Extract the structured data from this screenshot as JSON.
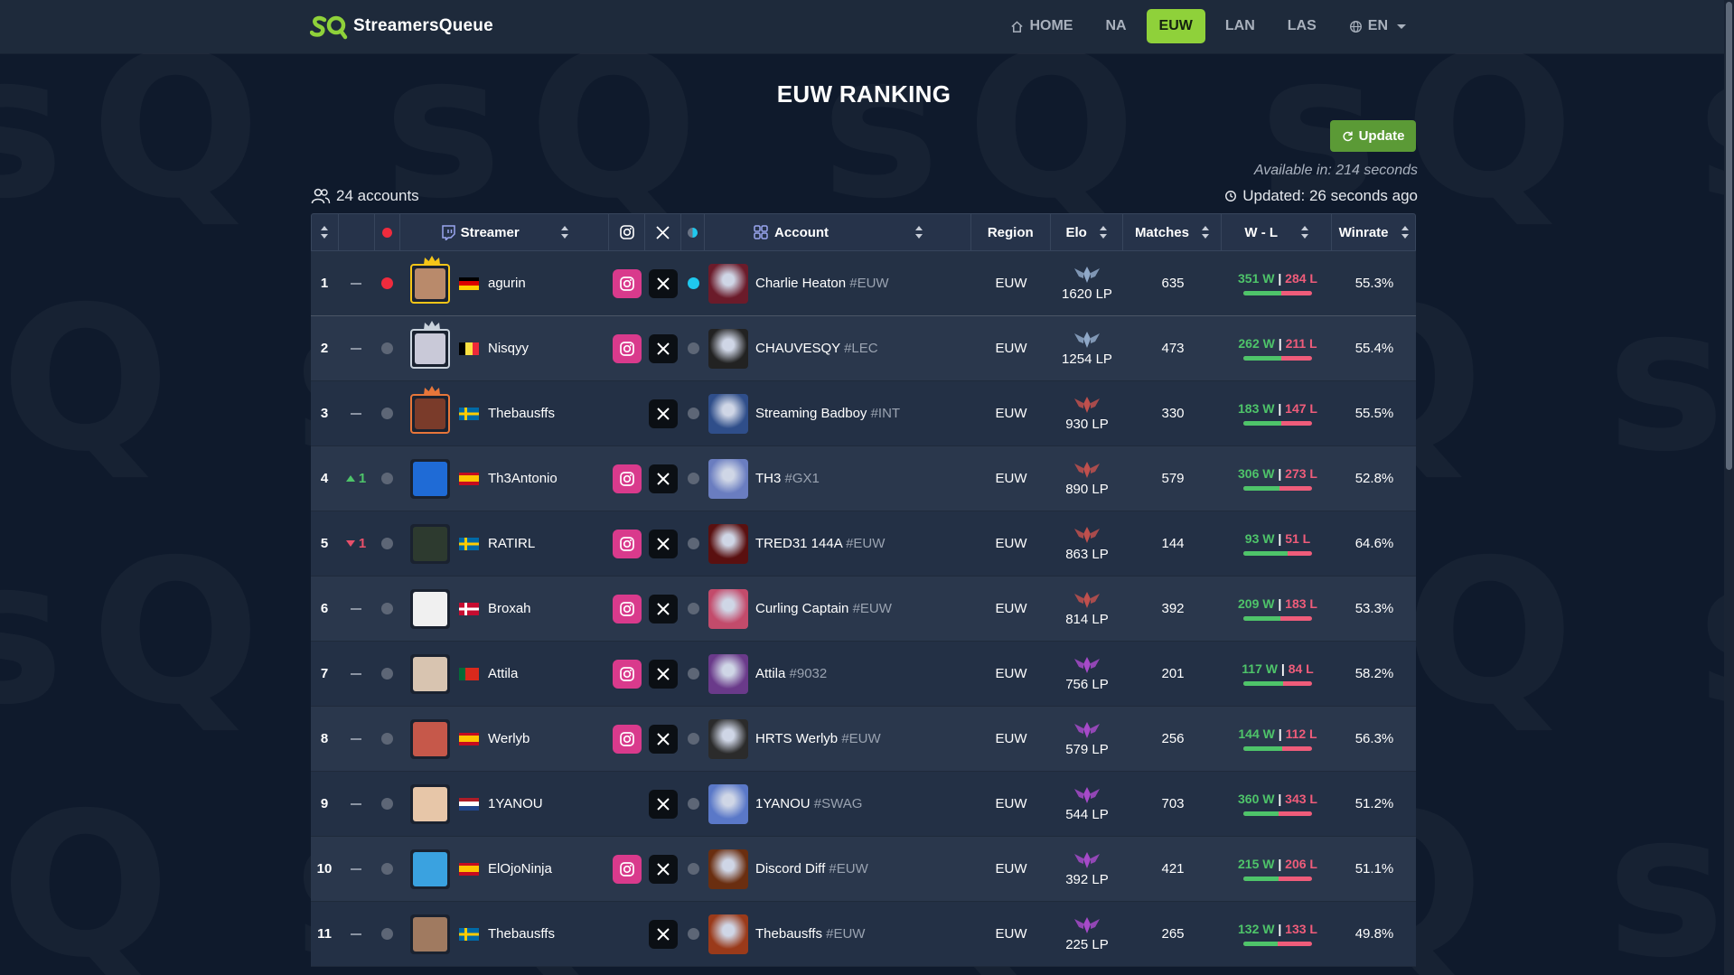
{
  "brand": {
    "name": "StreamersQueue",
    "logo_initials": "sQ"
  },
  "nav": [
    {
      "label": "HOME",
      "icon": "home-icon",
      "active": false
    },
    {
      "label": "NA",
      "active": false
    },
    {
      "label": "EUW",
      "active": true
    },
    {
      "label": "LAN",
      "active": false
    },
    {
      "label": "LAS",
      "active": false
    },
    {
      "label": "EN",
      "icon": "globe-icon",
      "active": false
    }
  ],
  "page": {
    "title": "EUW RANKING",
    "update_label": "Update",
    "available_text": "Available in: 214 seconds",
    "updated_text": "Updated: 26 seconds ago",
    "accounts_text": "24 accounts"
  },
  "table": {
    "headers": {
      "streamer": "Streamer",
      "account": "Account",
      "region": "Region",
      "elo": "Elo",
      "matches": "Matches",
      "wl": "W - L",
      "winrate": "Winrate"
    },
    "rows": [
      {
        "rank": "1",
        "change": "",
        "dir": "none",
        "live": "red",
        "streamer": "agurin",
        "flag": "de",
        "crown": "gold",
        "ig": true,
        "x": true,
        "acclive": "blue",
        "account": "Charlie Heaton",
        "tag": "#EUW",
        "region": "EUW",
        "tier": "challenger",
        "lp": "1620 LP",
        "matches": "635",
        "w": "351 W",
        "l": "284 L",
        "wr": "55.3%",
        "winfrac": 0.553
      },
      {
        "rank": "2",
        "change": "",
        "dir": "none",
        "live": "grey",
        "streamer": "Nisqyy",
        "flag": "be",
        "crown": "silver",
        "ig": true,
        "x": true,
        "acclive": "grey",
        "account": "CHAUVESQY",
        "tag": "#LEC",
        "region": "EUW",
        "tier": "challenger",
        "lp": "1254 LP",
        "matches": "473",
        "w": "262 W",
        "l": "211 L",
        "wr": "55.4%",
        "winfrac": 0.554
      },
      {
        "rank": "3",
        "change": "",
        "dir": "none",
        "live": "grey",
        "streamer": "Thebausffs",
        "flag": "se",
        "crown": "bronze",
        "ig": false,
        "x": true,
        "acclive": "grey",
        "account": "Streaming Badboy",
        "tag": "#INT",
        "region": "EUW",
        "tier": "grandmaster",
        "lp": "930 LP",
        "matches": "330",
        "w": "183 W",
        "l": "147 L",
        "wr": "55.5%",
        "winfrac": 0.555
      },
      {
        "rank": "4",
        "change": "1",
        "dir": "up",
        "live": "grey",
        "streamer": "Th3Antonio",
        "flag": "es",
        "crown": "",
        "ig": true,
        "x": true,
        "acclive": "grey",
        "account": "TH3",
        "tag": "#GX1",
        "region": "EUW",
        "tier": "grandmaster",
        "lp": "890 LP",
        "matches": "579",
        "w": "306 W",
        "l": "273 L",
        "wr": "52.8%",
        "winfrac": 0.528
      },
      {
        "rank": "5",
        "change": "1",
        "dir": "down",
        "live": "grey",
        "streamer": "RATIRL",
        "flag": "se",
        "crown": "",
        "ig": true,
        "x": true,
        "acclive": "grey",
        "account": "TRED31 144A",
        "tag": "#EUW",
        "region": "EUW",
        "tier": "grandmaster",
        "lp": "863 LP",
        "matches": "144",
        "w": "93 W",
        "l": "51 L",
        "wr": "64.6%",
        "winfrac": 0.646
      },
      {
        "rank": "6",
        "change": "",
        "dir": "none",
        "live": "grey",
        "streamer": "Broxah",
        "flag": "dk",
        "crown": "",
        "ig": true,
        "x": true,
        "acclive": "grey",
        "account": "Curling Captain",
        "tag": "#EUW",
        "region": "EUW",
        "tier": "grandmaster",
        "lp": "814 LP",
        "matches": "392",
        "w": "209 W",
        "l": "183 L",
        "wr": "53.3%",
        "winfrac": 0.533
      },
      {
        "rank": "7",
        "change": "",
        "dir": "none",
        "live": "grey",
        "streamer": "Attila",
        "flag": "pt",
        "crown": "",
        "ig": true,
        "x": true,
        "acclive": "grey",
        "account": "Attila",
        "tag": "#9032",
        "region": "EUW",
        "tier": "master",
        "lp": "756 LP",
        "matches": "201",
        "w": "117 W",
        "l": "84 L",
        "wr": "58.2%",
        "winfrac": 0.582
      },
      {
        "rank": "8",
        "change": "",
        "dir": "none",
        "live": "grey",
        "streamer": "Werlyb",
        "flag": "es",
        "crown": "",
        "ig": true,
        "x": true,
        "acclive": "grey",
        "account": "HRTS Werlyb",
        "tag": "#EUW",
        "region": "EUW",
        "tier": "master",
        "lp": "579 LP",
        "matches": "256",
        "w": "144 W",
        "l": "112 L",
        "wr": "56.3%",
        "winfrac": 0.563
      },
      {
        "rank": "9",
        "change": "",
        "dir": "none",
        "live": "grey",
        "streamer": "1YANOU",
        "flag": "nl",
        "crown": "",
        "ig": false,
        "x": true,
        "acclive": "grey",
        "account": "1YANOU",
        "tag": "#SWAG",
        "region": "EUW",
        "tier": "master",
        "lp": "544 LP",
        "matches": "703",
        "w": "360 W",
        "l": "343 L",
        "wr": "51.2%",
        "winfrac": 0.512
      },
      {
        "rank": "10",
        "change": "",
        "dir": "none",
        "live": "grey",
        "streamer": "ElOjoNinja",
        "flag": "es",
        "crown": "",
        "ig": true,
        "x": true,
        "acclive": "grey",
        "account": "Discord Diff",
        "tag": "#EUW",
        "region": "EUW",
        "tier": "master",
        "lp": "392 LP",
        "matches": "421",
        "w": "215 W",
        "l": "206 L",
        "wr": "51.1%",
        "winfrac": 0.511
      },
      {
        "rank": "11",
        "change": "",
        "dir": "none",
        "live": "grey",
        "streamer": "Thebausffs",
        "flag": "se",
        "crown": "",
        "ig": false,
        "x": true,
        "acclive": "grey",
        "account": "Thebausffs",
        "tag": "#EUW",
        "region": "EUW",
        "tier": "master",
        "lp": "225 LP",
        "matches": "265",
        "w": "132 W",
        "l": "133 L",
        "wr": "49.8%",
        "winfrac": 0.498
      }
    ]
  },
  "colors": {
    "accent": "#8fd13a",
    "win": "#4ec46a",
    "loss": "#ef5c7a",
    "live": "#ef2b3d",
    "online": "#1fc8ee"
  }
}
